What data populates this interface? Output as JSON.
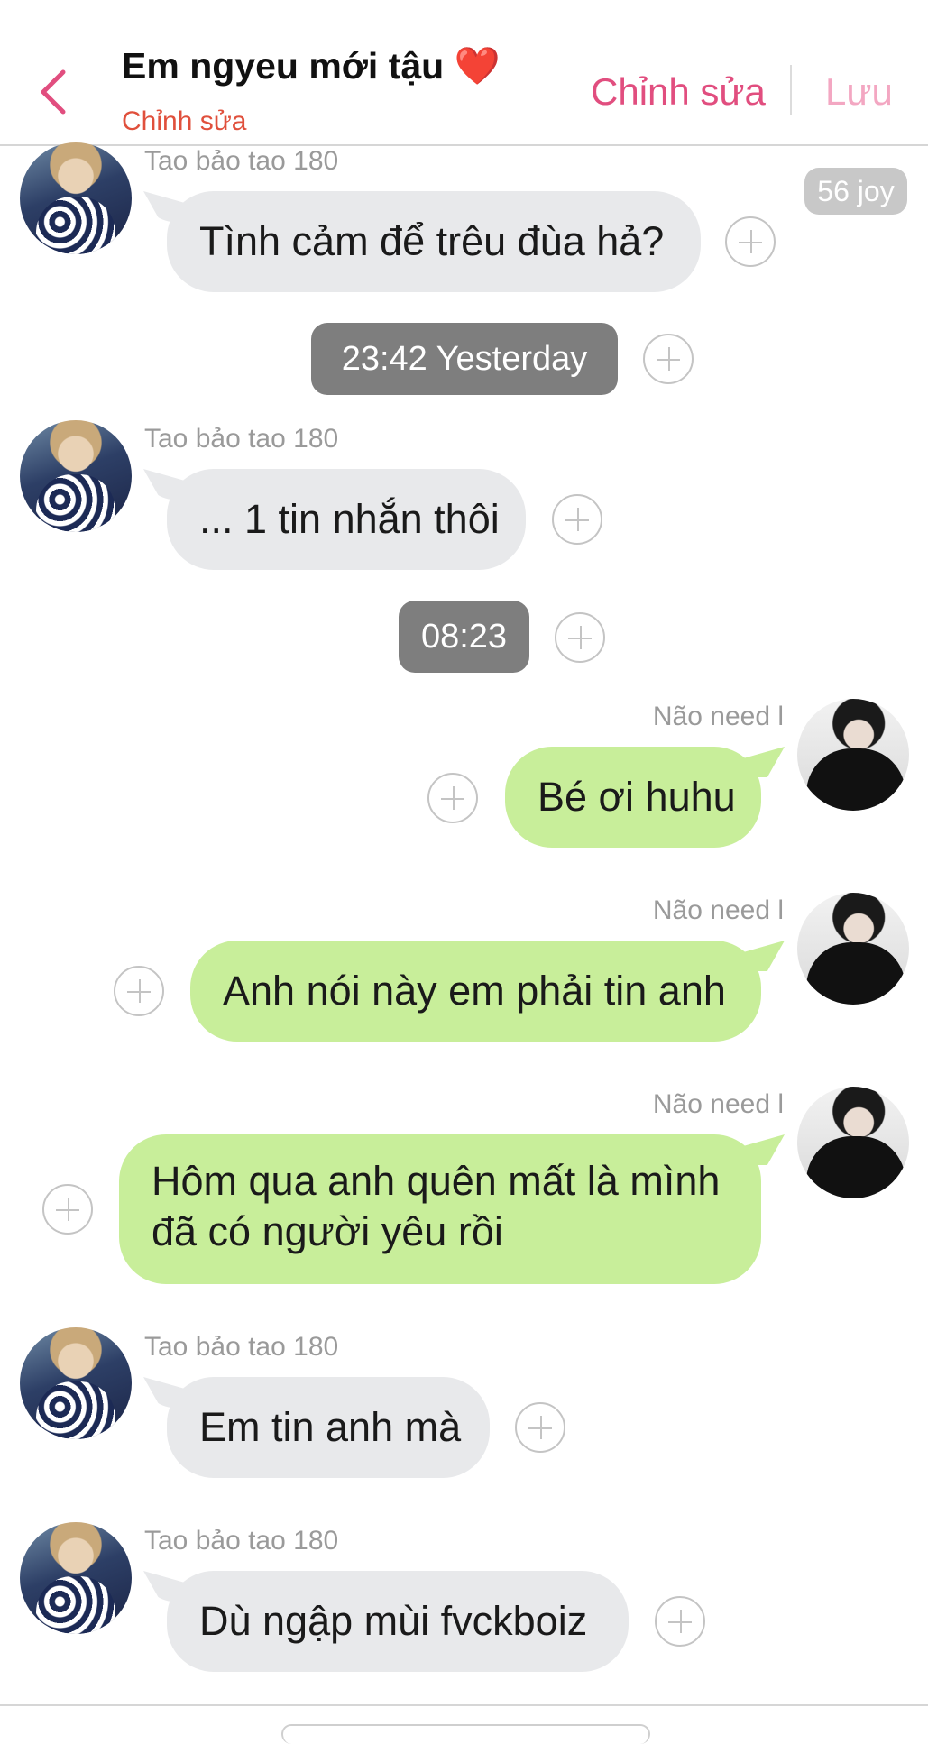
{
  "header": {
    "title": "Em ngyeu mới tậu ❤️",
    "subtitle": "Chỉnh sửa",
    "edit_label": "Chỉnh sửa",
    "save_label": "Lưu",
    "back_icon": "chevron-left-icon",
    "accent_color": "#e14e7f"
  },
  "badge": {
    "label": "56 joy"
  },
  "messages": [
    {
      "side": "left",
      "sender": "Tao bảo tao 180",
      "text": "Tình cảm để trêu đùa hả?"
    },
    {
      "type": "time",
      "text": "23:42 Yesterday"
    },
    {
      "side": "left",
      "sender": "Tao bảo tao 180",
      "text": "... 1 tin nhắn thôi"
    },
    {
      "type": "time",
      "text": "08:23"
    },
    {
      "side": "right",
      "sender": "Não need l",
      "text": "Bé ơi huhu"
    },
    {
      "side": "right",
      "sender": "Não need l",
      "text": "Anh nói này em phải tin anh"
    },
    {
      "side": "right",
      "sender": "Não need l",
      "text_line1": "Hôm qua anh quên mất là mình",
      "text_line2": "đã có người yêu rồi"
    },
    {
      "side": "left",
      "sender": "Tao bảo tao 180",
      "text": "Em tin anh mà"
    },
    {
      "side": "left",
      "sender": "Tao bảo tao 180",
      "text": "Dù ngập mùi fvckboiz"
    }
  ]
}
